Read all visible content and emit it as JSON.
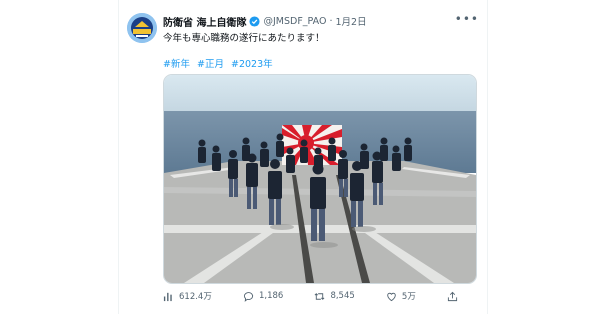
{
  "tweet": {
    "display_name": "防衛省 海上自衛隊",
    "handle": "@JMSDF_PAO",
    "separator": "·",
    "date": "1月2日",
    "text": "今年も専心職務の遂行にあたります！",
    "hashtags": [
      "#新年",
      "#正月",
      "#2023年"
    ],
    "more_icon": "more-horizontal-icon"
  },
  "avatar": {
    "label": "海上自衛隊"
  },
  "actions": {
    "views": "612.4万",
    "replies": "1,186",
    "retweets": "8,545",
    "likes": "5万"
  },
  "colors": {
    "link": "#1d9bf0",
    "verified": "#1d9bf0",
    "secondary_text": "#536471",
    "sea": "#6c87a0",
    "sky": "#d7e6ef",
    "deck": "#b7b9b8",
    "flag_red": "#d81e2c"
  }
}
